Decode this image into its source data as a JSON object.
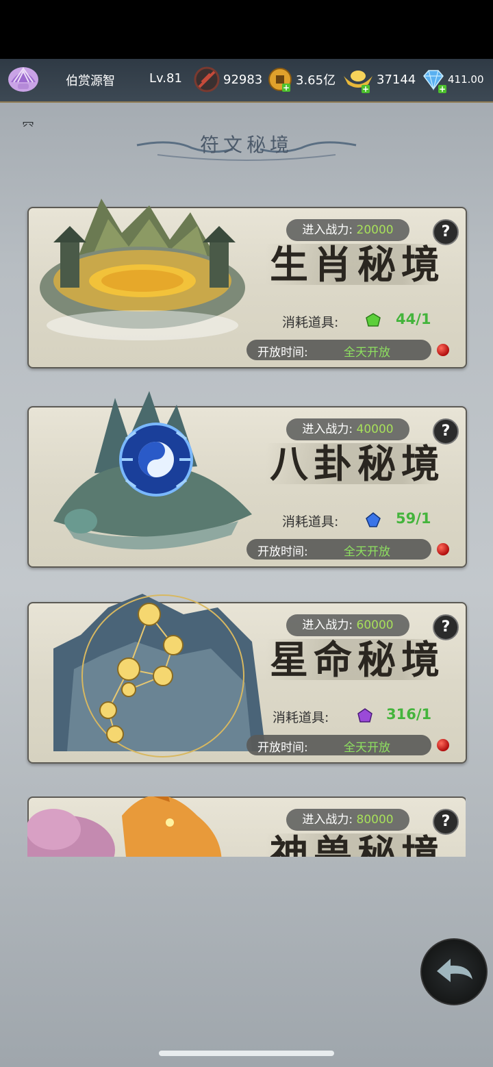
{
  "header": {
    "player_name": "伯赏源智",
    "level": "Lv.81",
    "resources": [
      {
        "icon": "combat-power-icon",
        "value": "92983"
      },
      {
        "icon": "coin-icon",
        "value": "3.65亿"
      },
      {
        "icon": "gold-ingot-icon",
        "value": "37144"
      },
      {
        "icon": "diamond-icon",
        "value": "411.00"
      }
    ],
    "side_glyph": "㓁"
  },
  "page_title": "符文秘境",
  "realms": [
    {
      "name": "生肖秘境",
      "power_label": "进入战力:",
      "power_value": "20000",
      "cost_label": "消耗道具:",
      "cost_value": "44/1",
      "time_label": "开放时间:",
      "time_value": "全天开放",
      "gem_color": "#5ccf3a"
    },
    {
      "name": "八卦秘境",
      "power_label": "进入战力:",
      "power_value": "40000",
      "cost_label": "消耗道具:",
      "cost_value": "59/1",
      "time_label": "开放时间:",
      "time_value": "全天开放",
      "gem_color": "#3a74e8"
    },
    {
      "name": "星命秘境",
      "power_label": "进入战力:",
      "power_value": "60000",
      "cost_label": "消耗道具:",
      "cost_value": "316/1",
      "time_label": "开放时间:",
      "time_value": "全天开放",
      "gem_color": "#9a4ad8"
    },
    {
      "name": "神兽秘境",
      "power_label": "进入战力:",
      "power_value": "80000"
    }
  ],
  "help_glyph": "?"
}
